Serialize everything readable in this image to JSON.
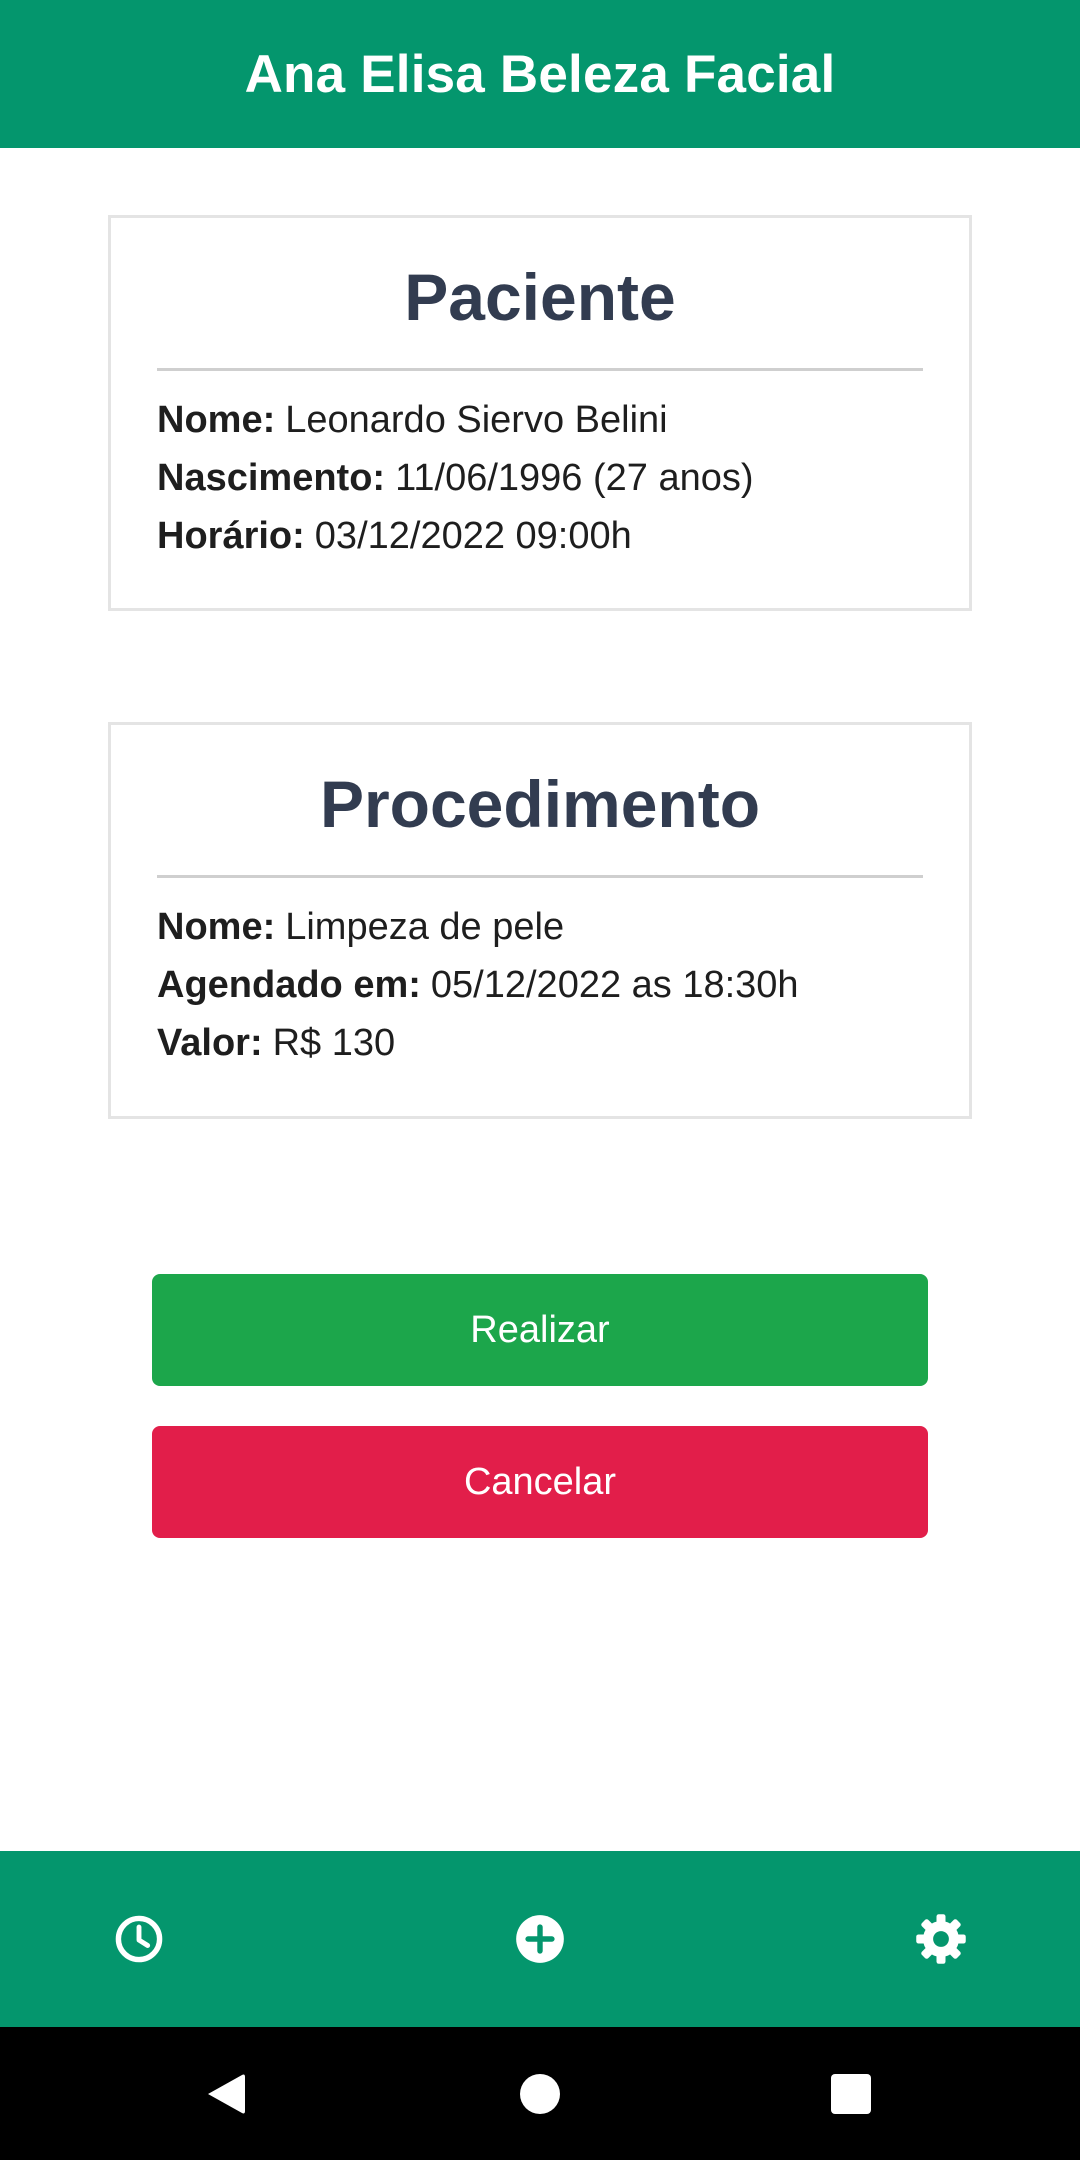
{
  "app": {
    "title": "Ana Elisa Beleza Facial"
  },
  "patient": {
    "title": "Paciente",
    "rows": [
      {
        "label": "Nome:",
        "value": "Leonardo Siervo Belini"
      },
      {
        "label": "Nascimento:",
        "value": "11/06/1996 (27 anos)"
      },
      {
        "label": "Horário:",
        "value": "03/12/2022 09:00h"
      }
    ]
  },
  "procedure": {
    "title": "Procedimento",
    "rows": [
      {
        "label": "Nome:",
        "value": "Limpeza de pele"
      },
      {
        "label": "Agendado em:",
        "value": "05/12/2022 as 18:30h"
      },
      {
        "label": "Valor:",
        "value": "R$ 130"
      }
    ]
  },
  "actions": {
    "realizar_label": "Realizar",
    "cancelar_label": "Cancelar"
  },
  "bottom_nav": {
    "items": [
      {
        "icon": "clock-icon"
      },
      {
        "icon": "add-circle-icon"
      },
      {
        "icon": "gear-icon"
      }
    ]
  },
  "system_nav": {
    "items": [
      {
        "icon": "back-triangle-icon"
      },
      {
        "icon": "home-circle-icon"
      },
      {
        "icon": "recents-square-icon"
      }
    ]
  },
  "colors": {
    "primary": "#04966d",
    "title_text": "#323c50",
    "realizar": "#1ca64b",
    "cancelar": "#e21e4a"
  }
}
